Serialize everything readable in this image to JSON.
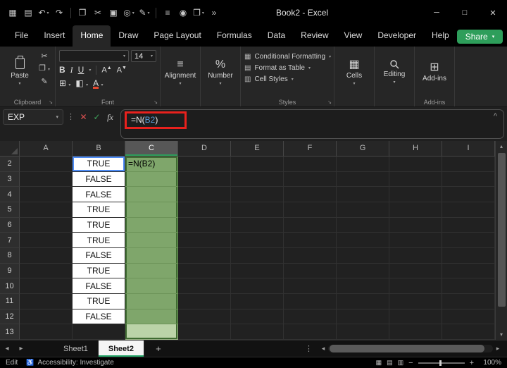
{
  "colors": {
    "titlebar_bg": "#000000",
    "ribbon_bg": "#262626",
    "grid_bg": "#212121",
    "share_green": "#2E9E5B",
    "sheet_accent_green": "#21A366",
    "selection_fill_green": "#7FA66B",
    "selection_fill_green_light": "#BBD3A8",
    "reference_blue": "#5B9BD5",
    "annotation_red": "#E8211D",
    "cell_white": "#FFFFFF"
  },
  "icons": {
    "dropdown": "▾",
    "minimize": "─",
    "maximize": "□",
    "close": "✕",
    "cancel": "✕",
    "enter": "✓",
    "fx": "fx",
    "dots": "⋮",
    "prev": "◂",
    "next": "▸",
    "up": "▴",
    "down": "▾",
    "collapse": "^",
    "alignment": "≡",
    "percent": "%",
    "cells": "▦",
    "addins": "⊞",
    "borders": "⊞",
    "fill": "◧",
    "cut": "✂",
    "copy": "❐",
    "painter": "✎",
    "launcher": "↘",
    "accessibility": "♿",
    "view_normal": "▦",
    "view_layout": "▤",
    "view_break": "▥",
    "minus": "−",
    "plus": "+",
    "add_sheet": "+"
  },
  "title_bar": {
    "title": "Book2 - Excel",
    "qat": [
      {
        "name": "app-launcher-icon",
        "glyph": "▦"
      },
      {
        "name": "save-icon",
        "glyph": "▤"
      },
      {
        "name": "undo-icon",
        "glyph": "↶",
        "dropdown": true
      },
      {
        "name": "redo-icon",
        "glyph": "↷"
      },
      {
        "sep": true
      },
      {
        "name": "copy-icon",
        "glyph": "❐"
      },
      {
        "name": "cut-icon",
        "glyph": "✂"
      },
      {
        "name": "picture-icon",
        "glyph": "▣"
      },
      {
        "name": "notifications-icon",
        "glyph": "◎",
        "dropdown": true
      },
      {
        "name": "format-painter-icon",
        "glyph": "✎",
        "dropdown": true
      },
      {
        "sep": true
      },
      {
        "name": "document-icon",
        "glyph": "≡"
      },
      {
        "name": "camera-icon",
        "glyph": "◉"
      },
      {
        "name": "printer-icon",
        "glyph": "❒",
        "dropdown": true
      },
      {
        "name": "more-commands-icon",
        "glyph": "»"
      }
    ]
  },
  "menubar": {
    "tabs": [
      "File",
      "Insert",
      "Home",
      "Draw",
      "Page Layout",
      "Formulas",
      "Data",
      "Review",
      "View",
      "Developer",
      "Help"
    ],
    "active_tab": "Home",
    "share_label": "Share"
  },
  "ribbon": {
    "clipboard": {
      "group_label": "Clipboard",
      "paste_label": "Paste"
    },
    "font": {
      "group_label": "Font",
      "name": "",
      "size": "14",
      "bold": "B",
      "italic": "I",
      "underline": "U",
      "grow": "A",
      "shrink": "A",
      "color_letter": "A"
    },
    "alignment": {
      "label": "Alignment"
    },
    "number": {
      "label": "Number"
    },
    "styles": {
      "group_label": "Styles",
      "items": [
        {
          "icon": "▦",
          "label": "Conditional Formatting"
        },
        {
          "icon": "▤",
          "label": "Format as Table"
        },
        {
          "icon": "▥",
          "label": "Cell Styles"
        }
      ]
    },
    "cells": {
      "label": "Cells"
    },
    "editing": {
      "label": "Editing"
    },
    "addins": {
      "label": "Add-ins",
      "group_label": "Add-ins"
    }
  },
  "formula_bar": {
    "name_box": "EXP",
    "formula": {
      "prefix": "=N(",
      "ref": "B2",
      "suffix": ")"
    }
  },
  "grid": {
    "columns": [
      "A",
      "B",
      "C",
      "D",
      "E",
      "F",
      "G",
      "H",
      "I"
    ],
    "selected_column": "C",
    "rows": [
      {
        "n": "2",
        "B": "TRUE",
        "C": "=N(B2)"
      },
      {
        "n": "3",
        "B": "FALSE",
        "C": ""
      },
      {
        "n": "4",
        "B": "FALSE",
        "C": ""
      },
      {
        "n": "5",
        "B": "TRUE",
        "C": ""
      },
      {
        "n": "6",
        "B": "TRUE",
        "C": ""
      },
      {
        "n": "7",
        "B": "TRUE",
        "C": ""
      },
      {
        "n": "8",
        "B": "FALSE",
        "C": ""
      },
      {
        "n": "9",
        "B": "TRUE",
        "C": ""
      },
      {
        "n": "10",
        "B": "FALSE",
        "C": ""
      },
      {
        "n": "11",
        "B": "TRUE",
        "C": ""
      },
      {
        "n": "12",
        "B": "FALSE",
        "C": ""
      },
      {
        "n": "13",
        "B": "",
        "C": ""
      }
    ]
  },
  "sheet_bar": {
    "sheets": [
      {
        "name": "Sheet1",
        "active": false
      },
      {
        "name": "Sheet2",
        "active": true
      }
    ]
  },
  "status_bar": {
    "mode": "Edit",
    "accessibility": "Accessibility: Investigate",
    "zoom": "100%"
  }
}
